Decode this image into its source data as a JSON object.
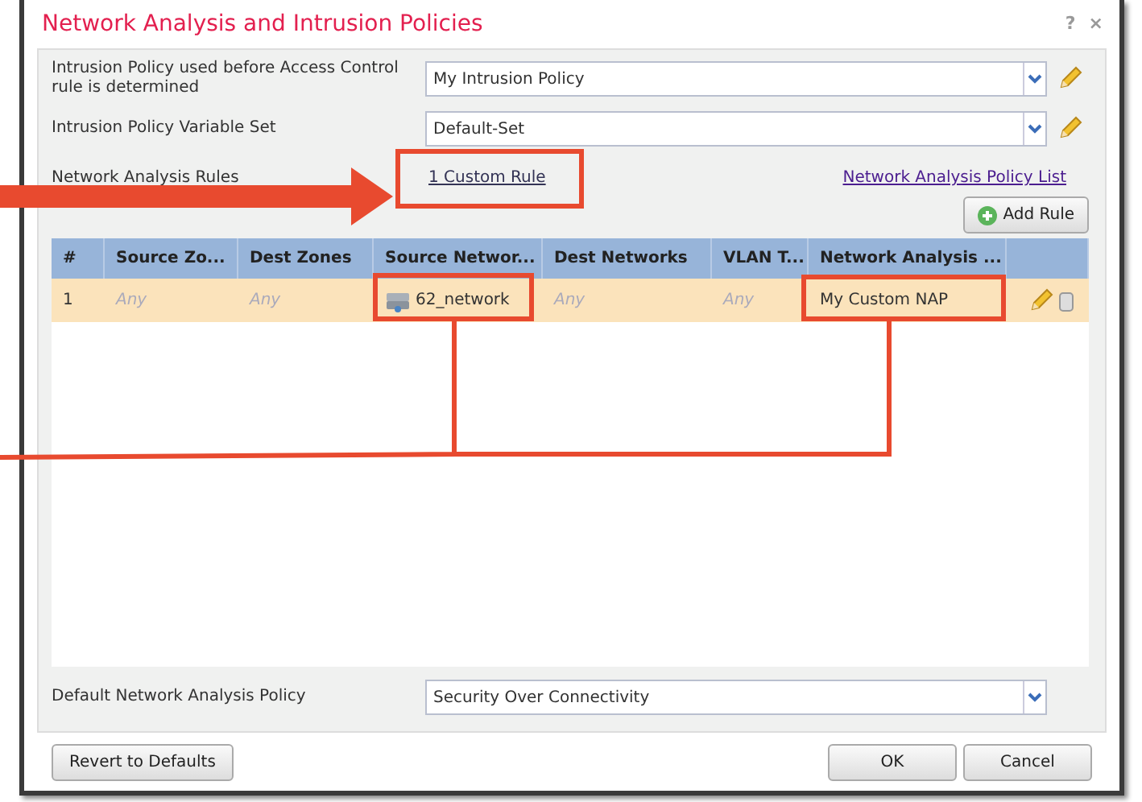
{
  "window": {
    "title": "Network Analysis and Intrusion Policies",
    "help": "?",
    "close": "×"
  },
  "fields": [
    {
      "label": "Intrusion Policy used before Access Control rule is determined",
      "value": "My Intrusion Policy",
      "edit_icon": true
    },
    {
      "label": "Intrusion Policy Variable Set",
      "value": "Default-Set",
      "edit_icon": true
    }
  ],
  "rules": {
    "label": "Network Analysis Rules",
    "custom_rule_link": "1 Custom Rule",
    "policy_list_link": "Network Analysis Policy List",
    "add_button": "Add Rule"
  },
  "table": {
    "columns": [
      "#",
      "Source Zo...",
      "Dest Zones",
      "Source Networ...",
      "Dest Networks",
      "VLAN T...",
      "Network Analysis ..."
    ],
    "rows": [
      {
        "selected": true,
        "cells": [
          {
            "kind": "text",
            "text": "1"
          },
          {
            "kind": "any",
            "text": "Any"
          },
          {
            "kind": "any",
            "text": "Any"
          },
          {
            "kind": "network",
            "text": "62_network"
          },
          {
            "kind": "any",
            "text": "Any"
          },
          {
            "kind": "any",
            "text": "Any"
          },
          {
            "kind": "text",
            "text": "My Custom NAP"
          }
        ]
      }
    ]
  },
  "default_policy": {
    "label": "Default Network Analysis Policy",
    "value": "Security Over Connectivity",
    "edit_icon": false
  },
  "buttons": {
    "revert": "Revert to Defaults",
    "ok": "OK",
    "cancel": "Cancel"
  }
}
